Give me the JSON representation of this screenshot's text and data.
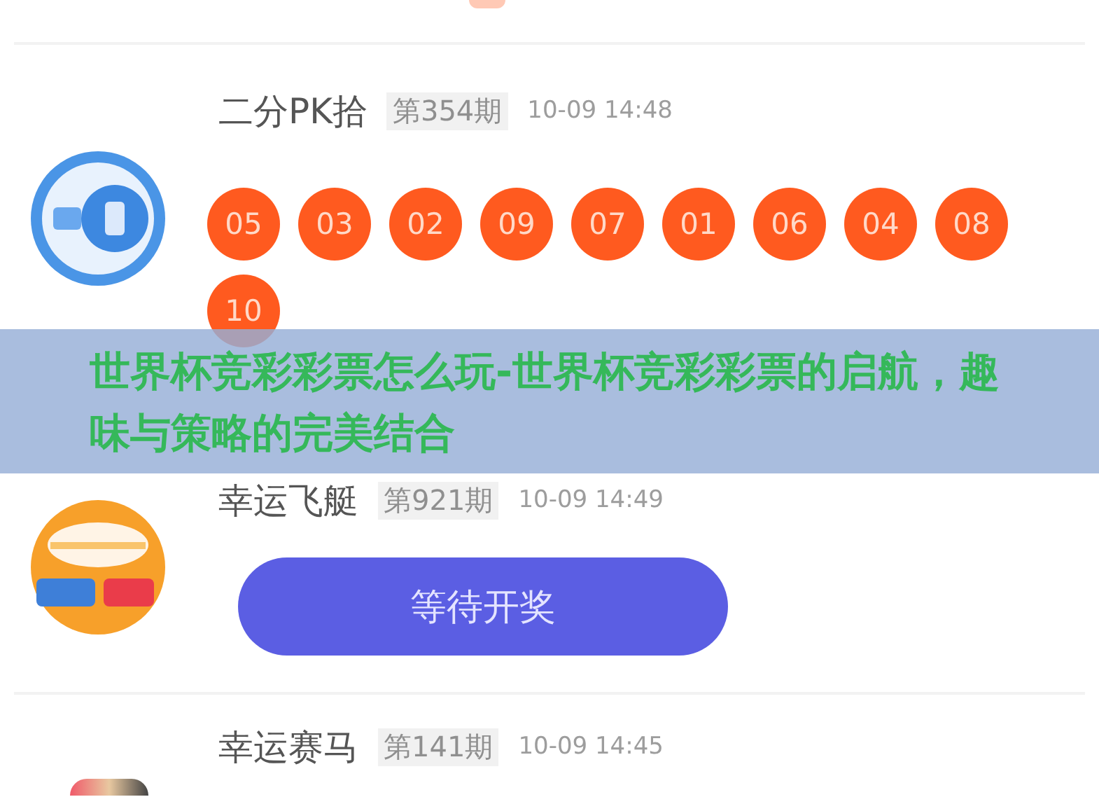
{
  "lotteries": [
    {
      "kind": "results",
      "name": "二分PK拾",
      "period": "第354期",
      "time": "10-09 14:48",
      "balls": [
        "05",
        "03",
        "02",
        "09",
        "07",
        "01",
        "06",
        "04",
        "08",
        "10"
      ]
    },
    {
      "kind": "pending",
      "name": "幸运飞艇",
      "period": "第921期",
      "time": "10-09 14:49",
      "action": "等待开奖"
    },
    {
      "kind": "partial",
      "name": "幸运赛马",
      "period": "第141期",
      "time": "10-09 14:45"
    }
  ],
  "banner": {
    "title": "世界杯竞彩彩票怎么玩-世界杯竞彩彩票的启航，趣味与策略的完美结合"
  }
}
